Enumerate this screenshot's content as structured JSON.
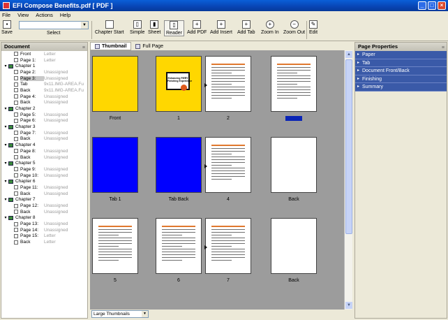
{
  "window": {
    "title": "EFI Compose Benefits.pdf [ PDF ]",
    "buttons": [
      "_",
      "□",
      "×"
    ]
  },
  "menu": [
    "File",
    "View",
    "Actions",
    "Help"
  ],
  "toolbar": {
    "save": "Save",
    "select_label": "Select",
    "select_value": "",
    "chapter_start": "Chapter Start",
    "simple": "Simple",
    "sheet": "Sheet",
    "reader": "Reader",
    "add_pdf": "Add PDF",
    "add_insert": "Add Insert",
    "add_tab": "Add Tab",
    "zoom_in": "Zoom In",
    "zoom_out": "Zoom Out",
    "edit": "Edit"
  },
  "document_panel": {
    "title": "Document",
    "rows": [
      {
        "name": "Front",
        "value": "Letter",
        "kind": "page",
        "indent": 1,
        "exp": ""
      },
      {
        "name": "Page 1:",
        "value": "Letter",
        "kind": "page",
        "indent": 1,
        "exp": ""
      },
      {
        "name": "Chapter 1",
        "value": "",
        "kind": "chapter",
        "indent": 0,
        "exp": "▾"
      },
      {
        "name": "Page 2:",
        "value": "Unassigned",
        "kind": "page",
        "indent": 1,
        "exp": ""
      },
      {
        "name": "Page 3:",
        "value": "Unassigned",
        "kind": "page",
        "indent": 1,
        "exp": "",
        "selected": true
      },
      {
        "name": "Tab",
        "value": "9x11.IMG-AREA.Fu",
        "kind": "page",
        "indent": 1,
        "exp": ""
      },
      {
        "name": "Back",
        "value": "9x11.IMG-AREA.Fu",
        "kind": "page",
        "indent": 1,
        "exp": ""
      },
      {
        "name": "Page 4:",
        "value": "Unassigned",
        "kind": "page",
        "indent": 1,
        "exp": ""
      },
      {
        "name": "Back",
        "value": "Unassigned",
        "kind": "page",
        "indent": 1,
        "exp": ""
      },
      {
        "name": "Chapter 2",
        "value": "",
        "kind": "chapter",
        "indent": 0,
        "exp": "▾"
      },
      {
        "name": "Page 5:",
        "value": "Unassigned",
        "kind": "page",
        "indent": 1,
        "exp": ""
      },
      {
        "name": "Page 6:",
        "value": "Unassigned",
        "kind": "page",
        "indent": 1,
        "exp": ""
      },
      {
        "name": "Chapter 3",
        "value": "",
        "kind": "chapter",
        "indent": 0,
        "exp": "▾"
      },
      {
        "name": "Page 7:",
        "value": "Unassigned",
        "kind": "page",
        "indent": 1,
        "exp": ""
      },
      {
        "name": "Back",
        "value": "Unassigned",
        "kind": "page",
        "indent": 1,
        "exp": ""
      },
      {
        "name": "Chapter 4",
        "value": "",
        "kind": "chapter",
        "indent": 0,
        "exp": "▾"
      },
      {
        "name": "Page 8:",
        "value": "Unassigned",
        "kind": "page",
        "indent": 1,
        "exp": ""
      },
      {
        "name": "Back",
        "value": "Unassigned",
        "kind": "page",
        "indent": 1,
        "exp": ""
      },
      {
        "name": "Chapter 5",
        "value": "",
        "kind": "chapter",
        "indent": 0,
        "exp": "▾"
      },
      {
        "name": "Page 9:",
        "value": "Unassigned",
        "kind": "page",
        "indent": 1,
        "exp": ""
      },
      {
        "name": "Page 10:",
        "value": "Unassigned",
        "kind": "page",
        "indent": 1,
        "exp": ""
      },
      {
        "name": "Chapter 6",
        "value": "",
        "kind": "chapter",
        "indent": 0,
        "exp": "▾"
      },
      {
        "name": "Page 11:",
        "value": "Unassigned",
        "kind": "page",
        "indent": 1,
        "exp": ""
      },
      {
        "name": "Back",
        "value": "Unassigned",
        "kind": "page",
        "indent": 1,
        "exp": ""
      },
      {
        "name": "Chapter 7",
        "value": "",
        "kind": "chapter",
        "indent": 0,
        "exp": "▾"
      },
      {
        "name": "Page 12:",
        "value": "Unassigned",
        "kind": "page",
        "indent": 1,
        "exp": ""
      },
      {
        "name": "Back",
        "value": "Unassigned",
        "kind": "page",
        "indent": 1,
        "exp": ""
      },
      {
        "name": "Chapter 8",
        "value": "",
        "kind": "chapter",
        "indent": 0,
        "exp": "▾"
      },
      {
        "name": "Page 13:",
        "value": "Unassigned",
        "kind": "page",
        "indent": 1,
        "exp": ""
      },
      {
        "name": "Page 14:",
        "value": "Unassigned",
        "kind": "page",
        "indent": 1,
        "exp": ""
      },
      {
        "name": "Page 15:",
        "value": "Letter",
        "kind": "page",
        "indent": 1,
        "exp": ""
      },
      {
        "name": "Back",
        "value": "Letter",
        "kind": "page",
        "indent": 1,
        "exp": ""
      }
    ]
  },
  "center": {
    "tabs": [
      "Thumbnail",
      "Full Page"
    ],
    "size_select": "Large Thumbnails"
  },
  "thumbnails": [
    {
      "label": "Front",
      "fill": "#ffd700",
      "content": "blank"
    },
    {
      "label": "1",
      "fill": "#ffd700",
      "content": "cover"
    },
    {
      "label": "2",
      "fill": "#ffffff",
      "content": "text"
    },
    {
      "label": "3",
      "fill": "#ffffff",
      "content": "text",
      "selected": true
    },
    {
      "label": "Tab 1",
      "fill": "#0000ff",
      "content": "blank"
    },
    {
      "label": "Tab Back",
      "fill": "#0000ff",
      "content": "blank"
    },
    {
      "label": "4",
      "fill": "#ffffff",
      "content": "text"
    },
    {
      "label": "Back",
      "fill": "#ffffff",
      "content": "blank"
    },
    {
      "label": "5",
      "fill": "#ffffff",
      "content": "text"
    },
    {
      "label": "6",
      "fill": "#ffffff",
      "content": "text"
    },
    {
      "label": "7",
      "fill": "#ffffff",
      "content": "text"
    },
    {
      "label": "Back",
      "fill": "#ffffff",
      "content": "blank"
    }
  ],
  "cover_text": "Enhancing FIERY\nFinishing Experience",
  "page_properties": {
    "title": "Page Properties",
    "items": [
      "Paper",
      "Tab",
      "Document Front/Back",
      "Finishing",
      "Summary"
    ]
  }
}
